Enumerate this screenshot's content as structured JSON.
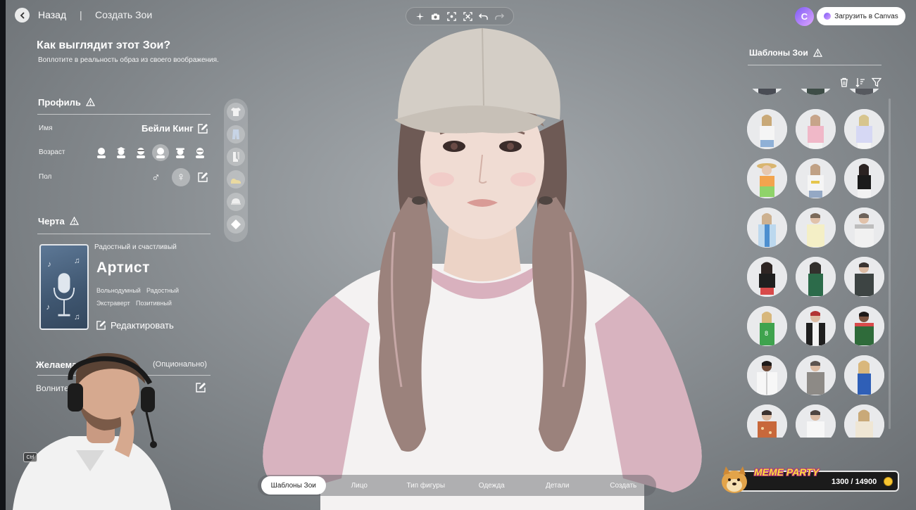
{
  "header": {
    "back_label": "Назад",
    "separator": "|",
    "breadcrumb": "Создать Зои",
    "upload_label": "Загрузить в Canvas",
    "canvas_logo": "C"
  },
  "toolbar": {
    "icons": [
      "sparkle-icon",
      "camera-icon",
      "frame-icon",
      "focus-icon",
      "undo-icon",
      "redo-icon"
    ]
  },
  "left": {
    "title": "Как выглядит этот Зои?",
    "subtitle": "Воплотите в реальность образ из своего воображения.",
    "profile": {
      "section": "Профиль",
      "name_label": "Имя",
      "name_value": "Бейли Кинг",
      "age_label": "Возраст",
      "gender_label": "Пол",
      "male_symbol": "♂",
      "female_symbol": "♀"
    },
    "trait": {
      "section": "Черта",
      "subtitle": "Радостный и счастливый",
      "name": "Артист",
      "tags": [
        "Вольнодумный",
        "Радостный",
        "Экстраверт",
        "Позитивный"
      ],
      "edit_label": "Редактировать"
    },
    "life": {
      "title": "Желаемая жи",
      "optional": "(Опционально)",
      "value": "Волните"
    }
  },
  "right": {
    "title": "Шаблоны Зои"
  },
  "bottom_nav": {
    "tabs": [
      {
        "label": "Шаблоны Зои",
        "active": true
      },
      {
        "label": "Лицо",
        "active": false
      },
      {
        "label": "Тип фигуры",
        "active": false
      },
      {
        "label": "Одежда",
        "active": false
      },
      {
        "label": "Детали",
        "active": false
      },
      {
        "label": "Создать",
        "active": false
      }
    ]
  },
  "overlay": {
    "ctrl_key": "Ctrl",
    "meme_title": "MEME PARTY",
    "meme_score": "1300 / 14900"
  },
  "colors": {
    "accent": "#ffffff",
    "canvas_purple": "#7d5cf5",
    "meme_yellow": "#ffdf3d"
  }
}
